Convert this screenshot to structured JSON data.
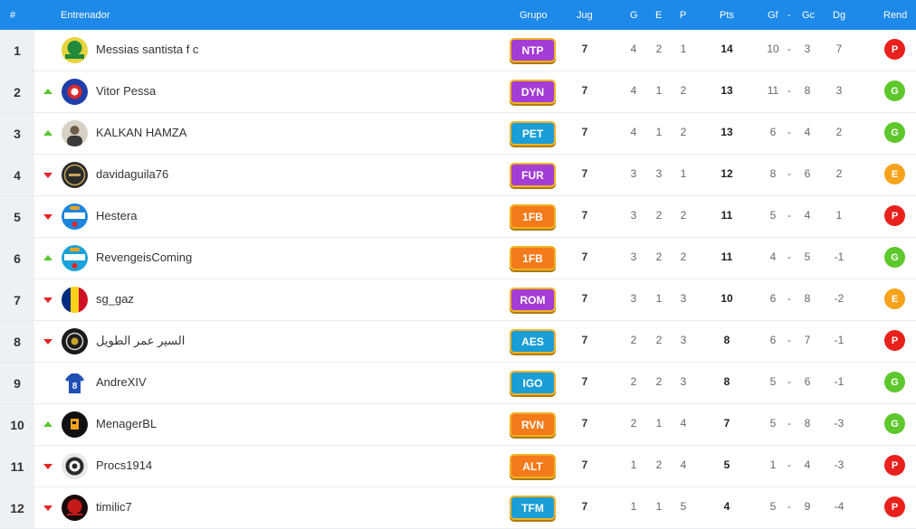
{
  "header": {
    "rank": "#",
    "coach": "Entrenador",
    "group": "Grupo",
    "played": "Jug",
    "won": "G",
    "drawn": "E",
    "lost": "P",
    "points": "Pts",
    "gf": "Gf",
    "sep": "-",
    "gc": "Gc",
    "dg": "Dg",
    "form": "Rend"
  },
  "colors": {
    "header_bg": "#1d89e8",
    "trend_up": "#58c72e",
    "trend_down": "#e32424",
    "form_P": "#e8211c",
    "form_G": "#5ec72c",
    "form_E": "#f7a21b"
  },
  "rows": [
    {
      "rank": "1",
      "trend": "none",
      "avatar": "green-yellow-crest",
      "name": "Messias santista f c",
      "group": "NTP",
      "group_color": "#a43cd6",
      "played": "7",
      "won": "4",
      "drawn": "2",
      "lost": "1",
      "points": "14",
      "gf": "10",
      "sep": "-",
      "gc": "3",
      "dg": "7",
      "form": "P"
    },
    {
      "rank": "2",
      "trend": "up",
      "avatar": "blue-red-crest",
      "name": "Vitor Pessa",
      "group": "DYN",
      "group_color": "#a43cd6",
      "played": "7",
      "won": "4",
      "drawn": "1",
      "lost": "2",
      "points": "13",
      "gf": "11",
      "sep": "-",
      "gc": "8",
      "dg": "3",
      "form": "G"
    },
    {
      "rank": "3",
      "trend": "up",
      "avatar": "person-photo",
      "name": "KALKAN HAMZA",
      "group": "PET",
      "group_color": "#1a9ed8",
      "played": "7",
      "won": "4",
      "drawn": "1",
      "lost": "2",
      "points": "13",
      "gf": "6",
      "sep": "-",
      "gc": "4",
      "dg": "2",
      "form": "G"
    },
    {
      "rank": "4",
      "trend": "down",
      "avatar": "furia-logo",
      "name": "davidaguila76",
      "group": "FUR",
      "group_color": "#a43cd6",
      "played": "7",
      "won": "3",
      "drawn": "3",
      "lost": "1",
      "points": "12",
      "gf": "8",
      "sep": "-",
      "gc": "6",
      "dg": "2",
      "form": "E"
    },
    {
      "rank": "5",
      "trend": "down",
      "avatar": "community-manager-badge",
      "name": "Hestera",
      "group": "1FB",
      "group_color": "#f47a1a",
      "played": "7",
      "won": "3",
      "drawn": "2",
      "lost": "2",
      "points": "11",
      "gf": "5",
      "sep": "-",
      "gc": "4",
      "dg": "1",
      "form": "P"
    },
    {
      "rank": "6",
      "trend": "up",
      "avatar": "staff-support-badge",
      "name": "RevengeisComing",
      "group": "1FB",
      "group_color": "#f47a1a",
      "played": "7",
      "won": "3",
      "drawn": "2",
      "lost": "2",
      "points": "11",
      "gf": "4",
      "sep": "-",
      "gc": "5",
      "dg": "-1",
      "form": "G"
    },
    {
      "rank": "7",
      "trend": "down",
      "avatar": "romania-flag",
      "name": "sg_gaz",
      "group": "ROM",
      "group_color": "#a43cd6",
      "played": "7",
      "won": "3",
      "drawn": "1",
      "lost": "3",
      "points": "10",
      "gf": "6",
      "sep": "-",
      "gc": "8",
      "dg": "-2",
      "form": "E"
    },
    {
      "rank": "8",
      "trend": "down",
      "avatar": "dark-crest",
      "name": "السير عمر الطويل",
      "group": "AES",
      "group_color": "#1a9ed8",
      "played": "7",
      "won": "2",
      "drawn": "2",
      "lost": "3",
      "points": "8",
      "gf": "6",
      "sep": "-",
      "gc": "7",
      "dg": "-1",
      "form": "P"
    },
    {
      "rank": "9",
      "trend": "none",
      "avatar": "jersey-8",
      "name": "AndreXIV",
      "group": "IGO",
      "group_color": "#1a9ed8",
      "played": "7",
      "won": "2",
      "drawn": "2",
      "lost": "3",
      "points": "8",
      "gf": "5",
      "sep": "-",
      "gc": "6",
      "dg": "-1",
      "form": "G"
    },
    {
      "rank": "10",
      "trend": "up",
      "avatar": "revenge-logo",
      "name": "MenagerBL",
      "group": "RVN",
      "group_color": "#f47a1a",
      "played": "7",
      "won": "2",
      "drawn": "1",
      "lost": "4",
      "points": "7",
      "gf": "5",
      "sep": "-",
      "gc": "8",
      "dg": "-3",
      "form": "G"
    },
    {
      "rank": "11",
      "trend": "down",
      "avatar": "bw-emblem",
      "name": "Procs1914",
      "group": "ALT",
      "group_color": "#f47a1a",
      "played": "7",
      "won": "1",
      "drawn": "2",
      "lost": "4",
      "points": "5",
      "gf": "1",
      "sep": "-",
      "gc": "4",
      "dg": "-3",
      "form": "P"
    },
    {
      "rank": "12",
      "trend": "down",
      "avatar": "red-dark-logo",
      "name": "timilic7",
      "group": "TFM",
      "group_color": "#1a9ed8",
      "played": "7",
      "won": "1",
      "drawn": "1",
      "lost": "5",
      "points": "4",
      "gf": "5",
      "sep": "-",
      "gc": "9",
      "dg": "-4",
      "form": "P"
    }
  ]
}
